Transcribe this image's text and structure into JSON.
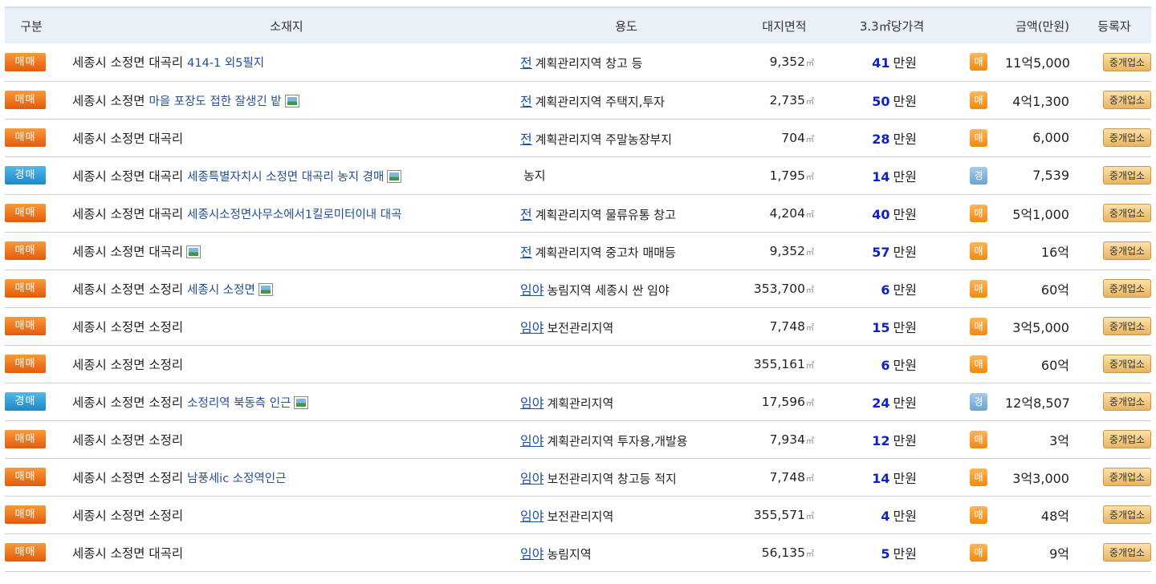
{
  "header": {
    "type": "구분",
    "location": "소재지",
    "usage": "용도",
    "area": "대지면적",
    "price_per": "3.3㎡당가격",
    "amount": "금액(만원)",
    "registrant": "등록자"
  },
  "area_unit": "㎡",
  "price_unit": "만원",
  "colors": {
    "sale": "#e86a16",
    "auction": "#2a95d0",
    "price": "#1020c8",
    "link": "#1a4fb3"
  },
  "rows": [
    {
      "type": "매매",
      "kind": "sale",
      "location": "세종시 소정면 대곡리",
      "desc": "414-1 외5필지",
      "photo": false,
      "category": "전",
      "zone": "계획관리지역 창고 등",
      "area": "9,352",
      "price": "41",
      "mark": "매",
      "amount": "11억5,000",
      "registrant": "중개업소"
    },
    {
      "type": "매매",
      "kind": "sale",
      "location": "세종시 소정면",
      "desc": "마을 포장도 접한 잘생긴 밭",
      "photo": true,
      "category": "전",
      "zone": "계획관리지역 주택지,투자",
      "area": "2,735",
      "price": "50",
      "mark": "매",
      "amount": "4억1,300",
      "registrant": "중개업소"
    },
    {
      "type": "매매",
      "kind": "sale",
      "location": "세종시 소정면 대곡리",
      "desc": "",
      "photo": false,
      "category": "전",
      "zone": "계획관리지역 주말농장부지",
      "area": "704",
      "price": "28",
      "mark": "매",
      "amount": "6,000",
      "registrant": "중개업소"
    },
    {
      "type": "경매",
      "kind": "auction",
      "location": "세종시 소정면 대곡리",
      "desc": "세종특별자치시 소정면 대곡리 농지 경매",
      "photo": true,
      "category": "",
      "zone": "농지",
      "area": "1,795",
      "price": "14",
      "mark": "경",
      "amount": "7,539",
      "registrant": "중개업소"
    },
    {
      "type": "매매",
      "kind": "sale",
      "location": "세종시 소정면 대곡리",
      "desc": "세종시소정면사무소에서1킬로미터이내 대곡",
      "photo": false,
      "category": "전",
      "zone": "계획관리지역 물류유통 창고",
      "area": "4,204",
      "price": "40",
      "mark": "매",
      "amount": "5억1,000",
      "registrant": "중개업소"
    },
    {
      "type": "매매",
      "kind": "sale",
      "location": "세종시 소정면 대곡리",
      "desc": "",
      "photo": true,
      "category": "전",
      "zone": "계획관리지역 중고차 매매등",
      "area": "9,352",
      "price": "57",
      "mark": "매",
      "amount": "16억",
      "registrant": "중개업소"
    },
    {
      "type": "매매",
      "kind": "sale",
      "location": "세종시 소정면 소정리",
      "desc": "세종시 소정면",
      "photo": true,
      "category": "임야",
      "zone": "농림지역 세종시 싼 임야",
      "area": "353,700",
      "price": "6",
      "mark": "매",
      "amount": "60억",
      "registrant": "중개업소"
    },
    {
      "type": "매매",
      "kind": "sale",
      "location": "세종시 소정면 소정리",
      "desc": "",
      "photo": false,
      "category": "임야",
      "zone": "보전관리지역",
      "area": "7,748",
      "price": "15",
      "mark": "매",
      "amount": "3억5,000",
      "registrant": "중개업소"
    },
    {
      "type": "매매",
      "kind": "sale",
      "location": "세종시 소정면 소정리",
      "desc": "",
      "photo": false,
      "category": "",
      "zone": "",
      "area": "355,161",
      "price": "6",
      "mark": "매",
      "amount": "60억",
      "registrant": "중개업소"
    },
    {
      "type": "경매",
      "kind": "auction",
      "location": "세종시 소정면 소정리",
      "desc": "소정리역 북동측 인근",
      "photo": true,
      "category": "임야",
      "zone": "계획관리지역",
      "area": "17,596",
      "price": "24",
      "mark": "경",
      "amount": "12억8,507",
      "registrant": "중개업소"
    },
    {
      "type": "매매",
      "kind": "sale",
      "location": "세종시 소정면 소정리",
      "desc": "",
      "photo": false,
      "category": "임야",
      "zone": "계획관리지역 투자용,개발용",
      "area": "7,934",
      "price": "12",
      "mark": "매",
      "amount": "3억",
      "registrant": "중개업소"
    },
    {
      "type": "매매",
      "kind": "sale",
      "location": "세종시 소정면 소정리",
      "desc": "남풍세ic 소정역인근",
      "photo": false,
      "category": "임야",
      "zone": "보전관리지역 창고등 적지",
      "area": "7,748",
      "price": "14",
      "mark": "매",
      "amount": "3억3,000",
      "registrant": "중개업소"
    },
    {
      "type": "매매",
      "kind": "sale",
      "location": "세종시 소정면 소정리",
      "desc": "",
      "photo": false,
      "category": "임야",
      "zone": "보전관리지역",
      "area": "355,571",
      "price": "4",
      "mark": "매",
      "amount": "48억",
      "registrant": "중개업소"
    },
    {
      "type": "매매",
      "kind": "sale",
      "location": "세종시 소정면 대곡리",
      "desc": "",
      "photo": false,
      "category": "임야",
      "zone": "농림지역",
      "area": "56,135",
      "price": "5",
      "mark": "매",
      "amount": "9억",
      "registrant": "중개업소"
    }
  ]
}
